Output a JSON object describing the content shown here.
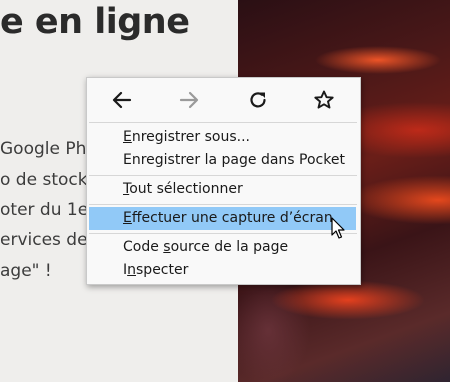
{
  "page": {
    "heading": "e en ligne",
    "lines": [
      "Google Ph",
      "o de stocka",
      "oter du 1e",
      "ervices de",
      "age\" !"
    ]
  },
  "context_menu": {
    "nav": [
      {
        "name": "back",
        "icon": "arrow-left-icon",
        "enabled": true
      },
      {
        "name": "forward",
        "icon": "arrow-right-icon",
        "enabled": false
      },
      {
        "name": "reload",
        "icon": "reload-icon",
        "enabled": true
      },
      {
        "name": "bookmark",
        "icon": "star-icon",
        "enabled": true
      }
    ],
    "items": [
      {
        "label": "Enregistrer sous...",
        "access_key": "E"
      },
      {
        "label": "Enregistrer la page dans Pocket",
        "access_key": ""
      },
      {
        "label": "Tout sélectionner",
        "access_key": "T"
      },
      {
        "label": "Effectuer une capture d’écran",
        "access_key": "E",
        "highlighted": true
      },
      {
        "label": "Code source de la page",
        "access_key": "s"
      },
      {
        "label": "Inspecter",
        "access_key": "n"
      }
    ]
  },
  "colors": {
    "menu_bg": "#f9f9f9",
    "highlight": "#91c9f7",
    "icon_enabled": "#1a1a1a",
    "icon_disabled": "#9a9a9a"
  }
}
